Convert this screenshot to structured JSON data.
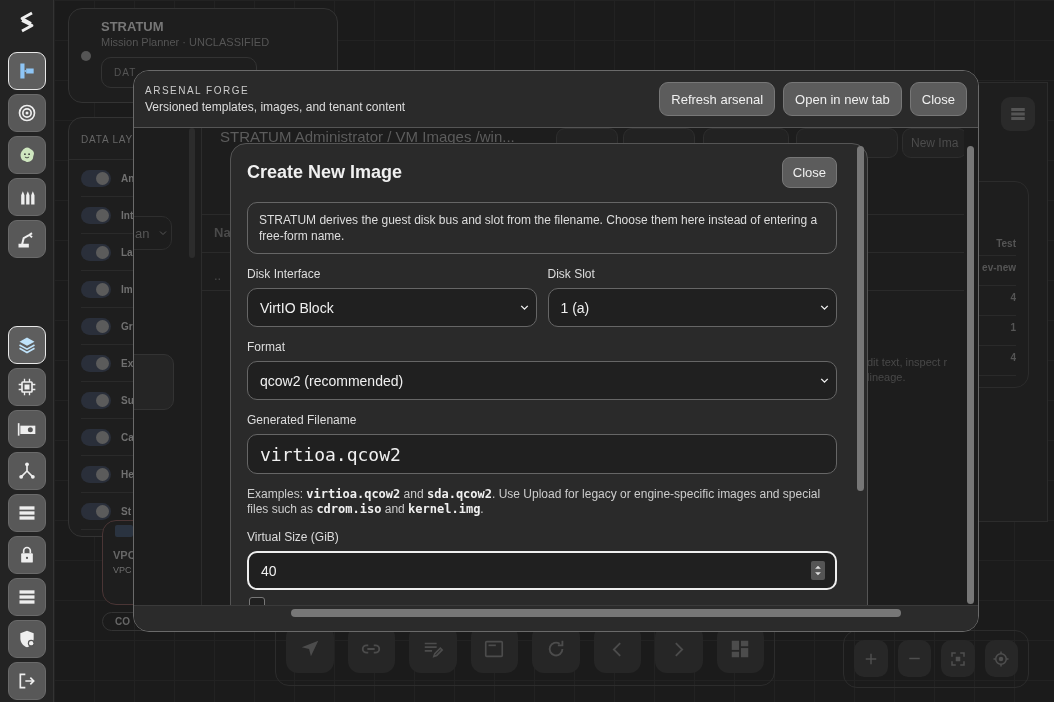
{
  "rail": {
    "top_items": [
      {
        "kind": "hierarchy",
        "selected": true
      },
      {
        "kind": "target",
        "selected": false
      },
      {
        "kind": "blob",
        "selected": false
      },
      {
        "kind": "ammo",
        "selected": false
      },
      {
        "kind": "robot-arm",
        "selected": false
      }
    ],
    "bottom_items": [
      {
        "kind": "layers",
        "selected": true
      },
      {
        "kind": "chip",
        "selected": false
      },
      {
        "kind": "card",
        "selected": false
      },
      {
        "kind": "network",
        "selected": false
      },
      {
        "kind": "list",
        "selected": false
      },
      {
        "kind": "lock",
        "selected": false
      },
      {
        "kind": "list",
        "selected": false
      },
      {
        "kind": "shield",
        "selected": false
      },
      {
        "kind": "logout",
        "selected": false
      }
    ]
  },
  "stratum_card": {
    "title": "STRATUM",
    "subtitle": "Mission Planner · UNCLASSIFIED",
    "button": "DAT"
  },
  "data_layers": {
    "title": "DATA LAY",
    "layers": [
      {
        "label": "An",
        "on": true
      },
      {
        "label": "Int",
        "on": true
      },
      {
        "label": "La",
        "on": true
      },
      {
        "label": "Im",
        "on": true
      },
      {
        "label": "Gr",
        "on": true
      },
      {
        "label": "Ex",
        "on": true
      },
      {
        "label": "Su",
        "on": true
      },
      {
        "label": "Ca",
        "on": true
      },
      {
        "label": "He",
        "on": true
      },
      {
        "label": "St",
        "on": true
      }
    ]
  },
  "canvas_node": {
    "title": "VPC",
    "subtitle": "VPC",
    "chip": "CO"
  },
  "right_panel": {
    "column": "Test",
    "cells": [
      "ev-new",
      "4",
      "1",
      "4"
    ]
  },
  "arsenal_forge": {
    "eyebrow": "ARSENAL FORGE",
    "subtitle": "Versioned templates, images, and tenant content",
    "buttons": [
      "Refresh arsenal",
      "Open in new tab",
      "Close"
    ],
    "side_select": "an",
    "breadcrumb": "STRATUM Administrator / VM Images /win...",
    "new_button": "New Ima",
    "table_header": "Na",
    "table_row": "..",
    "description_lines": [
      "dit text, inspect r",
      "lineage."
    ]
  },
  "create_image": {
    "title": "Create New Image",
    "close": "Close",
    "info": "STRATUM derives the guest disk bus and slot from the filename. Choose them here instead of entering a free-form name.",
    "rows": [
      [
        {
          "kind": "select",
          "label": "Disk Interface",
          "value": "VirtIO Block"
        },
        {
          "kind": "select",
          "label": "Disk Slot",
          "value": "1 (a)"
        }
      ],
      [
        {
          "kind": "select",
          "label": "Format",
          "value": "qcow2 (recommended)"
        }
      ],
      [
        {
          "kind": "text",
          "label": "Generated Filename",
          "value": "virtioa.qcow2"
        }
      ],
      [
        {
          "kind": "note",
          "text": "Examples: **virtioa.qcow2** and **sda.qcow2**. Use Upload for legacy or engine-specific images and special files such as **cdrom.iso** and **kernel.img**."
        }
      ],
      [
        {
          "kind": "number",
          "label": "Virtual Size (GiB)",
          "value": "40",
          "focused": true
        }
      ],
      [
        {
          "kind": "checkbox",
          "checked": false
        }
      ]
    ]
  },
  "map_toolbar": {
    "tools": [
      {
        "kind": "navigate"
      },
      {
        "kind": "link"
      },
      {
        "kind": "edit"
      },
      {
        "kind": "window"
      },
      {
        "kind": "refresh"
      },
      {
        "kind": "prev"
      },
      {
        "kind": "next"
      },
      {
        "kind": "dashboard"
      }
    ]
  },
  "zoom_controls": {
    "tools": [
      {
        "kind": "plus"
      },
      {
        "kind": "minus"
      },
      {
        "kind": "fit"
      },
      {
        "kind": "locate"
      }
    ]
  }
}
